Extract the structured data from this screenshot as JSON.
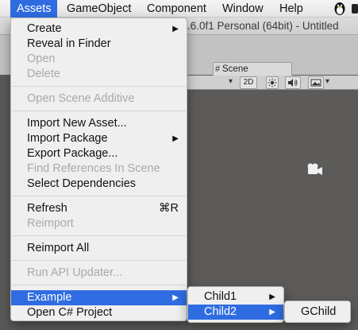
{
  "menubar": {
    "items": [
      "Assets",
      "GameObject",
      "Component",
      "Window",
      "Help"
    ],
    "active": "Assets",
    "status_icon": "penguin-icon",
    "right_icon": "menu-extra-icon"
  },
  "window": {
    "title": "y 5.6.0f1 Personal (64bit) - Untitled"
  },
  "scene": {
    "tab_label": "Scene",
    "tab_icon": "hash-icon",
    "toolbar": {
      "mode_2d": "2D",
      "light_icon": "sun-icon",
      "audio_icon": "speaker-icon",
      "image_icon": "image-icon"
    },
    "gizmo_icon": "camera-icon"
  },
  "assets_menu": {
    "create": "Create",
    "reveal": "Reveal in Finder",
    "open": "Open",
    "delete": "Delete",
    "open_scene_additive": "Open Scene Additive",
    "import_new_asset": "Import New Asset...",
    "import_package": "Import Package",
    "export_package": "Export Package...",
    "find_references": "Find References In Scene",
    "select_dependencies": "Select Dependencies",
    "refresh": "Refresh",
    "refresh_shortcut": "⌘R",
    "reimport": "Reimport",
    "reimport_all": "Reimport All",
    "run_api_updater": "Run API Updater...",
    "example": "Example",
    "open_csharp_project": "Open C# Project"
  },
  "example_menu": {
    "child1": "Child1",
    "child2": "Child2"
  },
  "child2_menu": {
    "gchild": "GChild"
  },
  "colors": {
    "highlight": "#2f6ce1",
    "menu_bg": "#efefef",
    "disabled_text": "#a9a9a9",
    "scene_bg": "#5d5b59"
  }
}
